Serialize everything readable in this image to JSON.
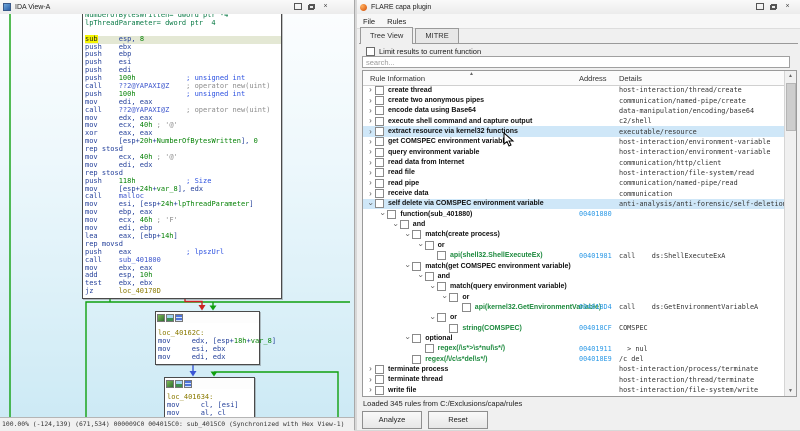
{
  "icons": {
    "close_icon": "×",
    "sort_ascending_icon": "▲",
    "scroll_up_icon": "▲",
    "scroll_down_icon": "▼"
  },
  "left_pane": {
    "title": "IDA View-A",
    "status": "100.00% (-124,139) (671,534) 000009C0 004015C0: sub_4015C0 (Synchronized with Hex View-1)",
    "blocks": {
      "block1": {
        "lines": [
          [
            [
              "grn",
              "NumberOfBytesWritten= dword ptr -4"
            ]
          ],
          [
            [
              "grn",
              "lpThreadParameter= dword ptr  4"
            ]
          ],
          [],
          [
            [
              "hly",
              "sub"
            ],
            [
              "ins",
              "     esp, "
            ],
            [
              "num",
              "8"
            ]
          ],
          [
            [
              "ins",
              "push    ebx"
            ]
          ],
          [
            [
              "ins",
              "push    ebp"
            ]
          ],
          [
            [
              "ins",
              "push    esi"
            ]
          ],
          [
            [
              "ins",
              "push    edi"
            ]
          ],
          [
            [
              "ins",
              "push    "
            ],
            [
              "num",
              "100h"
            ],
            [
              "pln",
              "            "
            ],
            [
              "cmtb",
              "; unsigned int"
            ]
          ],
          [
            [
              "ins",
              "call    "
            ],
            [
              "name",
              "??2@YAPAXI@Z"
            ],
            [
              "pln",
              "    "
            ],
            [
              "cmt",
              "; operator new(uint)"
            ]
          ],
          [
            [
              "ins",
              "push    "
            ],
            [
              "num",
              "100h"
            ],
            [
              "pln",
              "            "
            ],
            [
              "cmtb",
              "; unsigned int"
            ]
          ],
          [
            [
              "ins",
              "mov     edi, eax"
            ]
          ],
          [
            [
              "ins",
              "call    "
            ],
            [
              "name",
              "??2@YAPAXI@Z"
            ],
            [
              "pln",
              "    "
            ],
            [
              "cmt",
              "; operator new(uint)"
            ]
          ],
          [
            [
              "ins",
              "mov     edx, eax"
            ]
          ],
          [
            [
              "ins",
              "mov     ecx, "
            ],
            [
              "num",
              "40h"
            ],
            [
              "pln",
              " "
            ],
            [
              "cmt",
              "; '@'"
            ]
          ],
          [
            [
              "ins",
              "xor     eax, eax"
            ]
          ],
          [
            [
              "ins",
              "mov     [esp+"
            ],
            [
              "num",
              "20h"
            ],
            [
              "ins",
              "+"
            ],
            [
              "var",
              "NumberOfBytesWritten"
            ],
            [
              "ins",
              "], "
            ],
            [
              "num",
              "0"
            ]
          ],
          [
            [
              "ins",
              "rep stosd"
            ]
          ],
          [
            [
              "ins",
              "mov     ecx, "
            ],
            [
              "num",
              "40h"
            ],
            [
              "pln",
              " "
            ],
            [
              "cmt",
              "; '@'"
            ]
          ],
          [
            [
              "ins",
              "mov     edi, edx"
            ]
          ],
          [
            [
              "ins",
              "rep stosd"
            ]
          ],
          [
            [
              "ins",
              "push    "
            ],
            [
              "num",
              "118h"
            ],
            [
              "pln",
              "            "
            ],
            [
              "cmtb",
              "; Size"
            ]
          ],
          [
            [
              "ins",
              "mov     [esp+"
            ],
            [
              "num",
              "24h"
            ],
            [
              "ins",
              "+"
            ],
            [
              "var",
              "var_8"
            ],
            [
              "ins",
              "], edx"
            ]
          ],
          [
            [
              "ins",
              "call    "
            ],
            [
              "name",
              "malloc"
            ]
          ],
          [
            [
              "ins",
              "mov     esi, [esp+"
            ],
            [
              "num",
              "24h"
            ],
            [
              "ins",
              "+"
            ],
            [
              "var",
              "lpThreadParameter"
            ],
            [
              "ins",
              "]"
            ]
          ],
          [
            [
              "ins",
              "mov     ebp, eax"
            ]
          ],
          [
            [
              "ins",
              "mov     ecx, "
            ],
            [
              "num",
              "46h"
            ],
            [
              "pln",
              " "
            ],
            [
              "cmt",
              "; 'F'"
            ]
          ],
          [
            [
              "ins",
              "mov     edi, ebp"
            ]
          ],
          [
            [
              "ins",
              "lea     eax, [ebp+"
            ],
            [
              "num",
              "14h"
            ],
            [
              "ins",
              "]"
            ]
          ],
          [
            [
              "ins",
              "rep movsd"
            ]
          ],
          [
            [
              "ins",
              "push    eax"
            ],
            [
              "pln",
              "             "
            ],
            [
              "cmtb",
              "; lpszUrl"
            ]
          ],
          [
            [
              "ins",
              "call    "
            ],
            [
              "name",
              "sub_401800"
            ]
          ],
          [
            [
              "ins",
              "mov     ebx, eax"
            ]
          ],
          [
            [
              "ins",
              "add     esp, "
            ],
            [
              "num",
              "10h"
            ]
          ],
          [
            [
              "ins",
              "test    ebx, ebx"
            ]
          ],
          [
            [
              "ins",
              "jz      "
            ],
            [
              "loc",
              "loc_40170D"
            ]
          ]
        ]
      },
      "block2": {
        "lines": [
          [
            [
              "loc",
              "loc_40162C:"
            ]
          ],
          [
            [
              "ins",
              "mov     edx, [esp+"
            ],
            [
              "num",
              "18h"
            ],
            [
              "ins",
              "+"
            ],
            [
              "var",
              "var_8"
            ],
            [
              "ins",
              "]"
            ]
          ],
          [
            [
              "ins",
              "mov     esi, ebx"
            ]
          ],
          [
            [
              "ins",
              "mov     edi, edx"
            ]
          ]
        ]
      },
      "block3": {
        "lines": [
          [
            [
              "loc",
              "loc_401634:"
            ]
          ],
          [
            [
              "ins",
              "mov     cl, [esi]"
            ]
          ],
          [
            [
              "ins",
              "mov     al, cl"
            ]
          ]
        ]
      }
    }
  },
  "right_pane": {
    "title": "FLARE capa plugin",
    "menu": [
      "File",
      "Rules"
    ],
    "tabs": [
      {
        "label": "Tree View",
        "active": true
      },
      {
        "label": "MITRE",
        "active": false
      }
    ],
    "limit_checkbox_label": "Limit results to current function",
    "search_placeholder": "search...",
    "table": {
      "columns": [
        "Rule Information",
        "Address",
        "Details"
      ],
      "rows": [
        {
          "i": 0,
          "a": ">",
          "l": "create thread",
          "d": "host-interaction/thread/create"
        },
        {
          "i": 0,
          "a": ">",
          "l": "create two anonymous pipes",
          "d": "communication/named-pipe/create"
        },
        {
          "i": 0,
          "a": ">",
          "l": "encode data using Base64",
          "d": "data-manipulation/encoding/base64"
        },
        {
          "i": 0,
          "a": ">",
          "l": "execute shell command and capture output",
          "d": "c2/shell"
        },
        {
          "i": 0,
          "a": ">",
          "l": "extract resource via kernel32 functions",
          "d": "executable/resource",
          "hl": true
        },
        {
          "i": 0,
          "a": ">",
          "l": "get COMSPEC environment variable",
          "d": "host-interaction/environment-variable"
        },
        {
          "i": 0,
          "a": ">",
          "l": "query environment variable",
          "d": "host-interaction/environment-variable"
        },
        {
          "i": 0,
          "a": ">",
          "l": "read data from Internet",
          "d": "communication/http/client"
        },
        {
          "i": 0,
          "a": ">",
          "l": "read file",
          "d": "host-interaction/file-system/read"
        },
        {
          "i": 0,
          "a": ">",
          "l": "read pipe",
          "d": "communication/named-pipe/read"
        },
        {
          "i": 0,
          "a": ">",
          "l": "receive data",
          "d": "communication"
        },
        {
          "i": 0,
          "a": "v",
          "l": "self delete via COMSPEC environment variable",
          "d": "anti-analysis/anti-forensic/self-deletion",
          "hl": true
        },
        {
          "i": 1,
          "a": "v",
          "l": "function(sub_401880)",
          "addr": "00401880"
        },
        {
          "i": 2,
          "a": "v",
          "l": "and"
        },
        {
          "i": 3,
          "a": "v",
          "l": "match(create process)"
        },
        {
          "i": 4,
          "a": "v",
          "l": "or"
        },
        {
          "i": 5,
          "a": "",
          "l": "api(shell32.ShellExecuteEx)",
          "c": "g",
          "addr": "00401981",
          "d": "call    ds:ShellExecuteExA"
        },
        {
          "i": 3,
          "a": "v",
          "l": "match(get COMSPEC environment variable)"
        },
        {
          "i": 4,
          "a": "v",
          "l": "and"
        },
        {
          "i": 5,
          "a": "v",
          "l": "match(query environment variable)"
        },
        {
          "i": 6,
          "a": "v",
          "l": "or"
        },
        {
          "i": 7,
          "a": "",
          "l": "api(kernel32.GetEnvironmentVariable)",
          "c": "g",
          "addr": "004018D4",
          "d": "call    ds:GetEnvironmentVariableA"
        },
        {
          "i": 5,
          "a": "v",
          "l": "or"
        },
        {
          "i": 6,
          "a": "",
          "l": "string(COMSPEC)",
          "c": "g",
          "addr": "004018CF",
          "d": "COMSPEC"
        },
        {
          "i": 3,
          "a": "v",
          "l": "optional"
        },
        {
          "i": 4,
          "a": "",
          "l": "regex(/\\s*>\\s*nul\\s*/)",
          "c": "g",
          "addr": "00401911",
          "d": "  > nul"
        },
        {
          "i": 3,
          "a": "",
          "l": "regex(/\\/c\\s*del\\s*/)",
          "c": "g",
          "addr": "004018E9",
          "d": "/c del"
        },
        {
          "i": 0,
          "a": ">",
          "l": "terminate process",
          "d": "host-interaction/process/terminate"
        },
        {
          "i": 0,
          "a": ">",
          "l": "terminate thread",
          "d": "host-interaction/thread/terminate"
        },
        {
          "i": 0,
          "a": ">",
          "l": "write file",
          "d": "host-interaction/file-system/write"
        }
      ]
    },
    "status": "Loaded 345 rules from C:/Exclusions/capa/rules",
    "buttons": {
      "analyze": "Analyze",
      "reset": "Reset"
    }
  }
}
